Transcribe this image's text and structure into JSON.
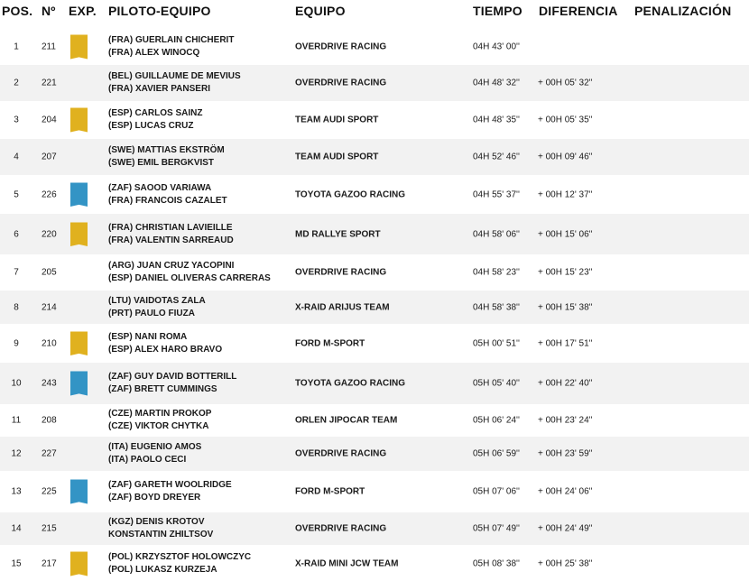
{
  "columns": {
    "pos": "POS.",
    "num": "Nº",
    "exp": "EXP.",
    "piloto": "PILOTO-EQUIPO",
    "equipo": "EQUIPO",
    "tiempo": "TIEMPO",
    "diferencia": "DIFERENCIA",
    "penalizacion": "PENALIZACIÓN"
  },
  "rows": [
    {
      "pos": "1",
      "num": "211",
      "exp": "gold",
      "p1": "(FRA)   GUERLAIN CHICHERIT",
      "p2": "(FRA)   ALEX WINOCQ",
      "team": "OVERDRIVE RACING",
      "time": "04H 43' 00''",
      "diff": "",
      "pen": ""
    },
    {
      "pos": "2",
      "num": "221",
      "exp": "none",
      "p1": "(BEL)   GUILLAUME DE MEVIUS",
      "p2": "(FRA)   XAVIER PANSERI",
      "team": "OVERDRIVE RACING",
      "time": "04H 48' 32''",
      "diff": "+ 00H 05' 32''",
      "pen": ""
    },
    {
      "pos": "3",
      "num": "204",
      "exp": "gold",
      "p1": "(ESP)   CARLOS SAINZ",
      "p2": "(ESP)   LUCAS CRUZ",
      "team": "TEAM AUDI SPORT",
      "time": "04H 48' 35''",
      "diff": "+ 00H 05' 35''",
      "pen": ""
    },
    {
      "pos": "4",
      "num": "207",
      "exp": "none",
      "p1": "(SWE)   MATTIAS EKSTRÖM",
      "p2": "(SWE)   EMIL BERGKVIST",
      "team": "TEAM AUDI SPORT",
      "time": "04H 52' 46''",
      "diff": "+ 00H 09' 46''",
      "pen": ""
    },
    {
      "pos": "5",
      "num": "226",
      "exp": "blue",
      "p1": "(ZAF)   SAOOD VARIAWA",
      "p2": "(FRA)   FRANCOIS CAZALET",
      "team": "TOYOTA GAZOO RACING",
      "time": "04H 55' 37''",
      "diff": "+ 00H 12' 37''",
      "pen": ""
    },
    {
      "pos": "6",
      "num": "220",
      "exp": "gold",
      "p1": "(FRA)   CHRISTIAN LAVIEILLE",
      "p2": "(FRA)   VALENTIN SARREAUD",
      "team": "MD RALLYE SPORT",
      "time": "04H 58' 06''",
      "diff": "+ 00H 15' 06''",
      "pen": ""
    },
    {
      "pos": "7",
      "num": "205",
      "exp": "none",
      "p1": "(ARG)   JUAN CRUZ YACOPINI",
      "p2": "(ESP)   DANIEL OLIVERAS CARRERAS",
      "team": "OVERDRIVE RACING",
      "time": "04H 58' 23''",
      "diff": "+ 00H 15' 23''",
      "pen": ""
    },
    {
      "pos": "8",
      "num": "214",
      "exp": "none",
      "p1": "(LTU)   VAIDOTAS ZALA",
      "p2": "(PRT)   PAULO FIUZA",
      "team": "X-RAID ARIJUS TEAM",
      "time": "04H 58' 38''",
      "diff": "+ 00H 15' 38''",
      "pen": ""
    },
    {
      "pos": "9",
      "num": "210",
      "exp": "gold",
      "p1": "(ESP)   NANI ROMA",
      "p2": "(ESP)   ALEX HARO BRAVO",
      "team": "FORD M-SPORT",
      "time": "05H 00' 51''",
      "diff": "+ 00H 17' 51''",
      "pen": ""
    },
    {
      "pos": "10",
      "num": "243",
      "exp": "blue",
      "p1": "(ZAF)   GUY DAVID BOTTERILL",
      "p2": "(ZAF)   BRETT CUMMINGS",
      "team": "TOYOTA GAZOO RACING",
      "time": "05H 05' 40''",
      "diff": "+ 00H 22' 40''",
      "pen": ""
    },
    {
      "pos": "11",
      "num": "208",
      "exp": "none",
      "p1": "(CZE)   MARTIN PROKOP",
      "p2": "(CZE)   VIKTOR CHYTKA",
      "team": "ORLEN JIPOCAR TEAM",
      "time": "05H 06' 24''",
      "diff": "+ 00H 23' 24''",
      "pen": ""
    },
    {
      "pos": "12",
      "num": "227",
      "exp": "none",
      "p1": "(ITA)   EUGENIO AMOS",
      "p2": "(ITA)   PAOLO CECI",
      "team": "OVERDRIVE RACING",
      "time": "05H 06' 59''",
      "diff": "+ 00H 23' 59''",
      "pen": ""
    },
    {
      "pos": "13",
      "num": "225",
      "exp": "blue",
      "p1": "(ZAF)   GARETH WOOLRIDGE",
      "p2": "(ZAF)   BOYD DREYER",
      "team": "FORD M-SPORT",
      "time": "05H 07' 06''",
      "diff": "+ 00H 24' 06''",
      "pen": ""
    },
    {
      "pos": "14",
      "num": "215",
      "exp": "none",
      "p1": "(KGZ)   DENIS KROTOV",
      "p2": "KONSTANTIN ZHILTSOV",
      "team": "OVERDRIVE RACING",
      "time": "05H 07' 49''",
      "diff": "+ 00H 24' 49''",
      "pen": ""
    },
    {
      "pos": "15",
      "num": "217",
      "exp": "gold",
      "p1": "(POL)   KRZYSZTOF HOLOWCZYC",
      "p2": "(POL)   LUKASZ KURZEJA",
      "team": "X-RAID MINI JCW TEAM",
      "time": "05H 08' 38''",
      "diff": "+ 00H 25' 38''",
      "pen": ""
    }
  ]
}
